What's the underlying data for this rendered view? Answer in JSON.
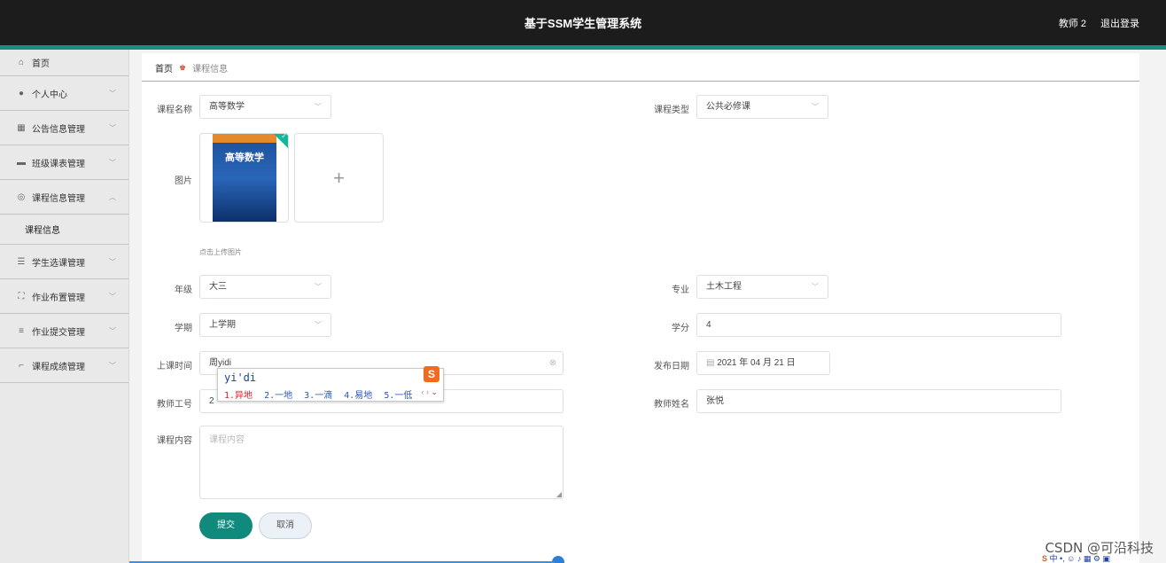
{
  "header": {
    "title": "基于SSM学生管理系统",
    "user": "教师 2",
    "logout": "退出登录"
  },
  "sidebar": {
    "items": [
      {
        "label": "首页",
        "icon": "home-icon"
      },
      {
        "label": "个人中心",
        "icon": "user-icon"
      },
      {
        "label": "公告信息管理",
        "icon": "grid-icon"
      },
      {
        "label": "班级课表管理",
        "icon": "briefcase-icon"
      },
      {
        "label": "课程信息管理",
        "icon": "compass-icon",
        "expanded": true
      },
      {
        "label": "学生选课管理",
        "icon": "list-icon"
      },
      {
        "label": "作业布置管理",
        "icon": "fullscreen-icon"
      },
      {
        "label": "作业提交管理",
        "icon": "sliders-icon"
      },
      {
        "label": "课程成绩管理",
        "icon": "crop-icon"
      }
    ],
    "sub_item": "课程信息"
  },
  "breadcrumb": {
    "home": "首页",
    "current": "课程信息"
  },
  "form": {
    "course_name_label": "课程名称",
    "course_name_value": "高等数学",
    "course_type_label": "课程类型",
    "course_type_value": "公共必修课",
    "image_label": "图片",
    "book_title": "高等数学",
    "upload_hint": "点击上传图片",
    "grade_label": "年级",
    "grade_value": "大三",
    "major_label": "专业",
    "major_value": "土木工程",
    "semester_label": "学期",
    "semester_value": "上学期",
    "credit_label": "学分",
    "credit_value": "4",
    "class_time_label": "上课时间",
    "class_time_value": "周yidi",
    "publish_date_label": "发布日期",
    "publish_date_value": "2021 年 04 月 21 日",
    "teacher_id_label": "教师工号",
    "teacher_id_value": "2",
    "teacher_name_label": "教师姓名",
    "teacher_name_value": "张悦",
    "content_label": "课程内容",
    "content_placeholder": "课程内容",
    "submit": "提交",
    "cancel": "取消"
  },
  "ime": {
    "composition": "yi'di",
    "candidates": [
      "1.异地",
      "2.一地",
      "3.一滴",
      "4.易地",
      "5.一低"
    ]
  },
  "watermark": "CSDN @可沿科技",
  "colors": {
    "accent": "#1e8c80",
    "submit": "#0f8a7c",
    "topbar": "#1c1c1c"
  }
}
